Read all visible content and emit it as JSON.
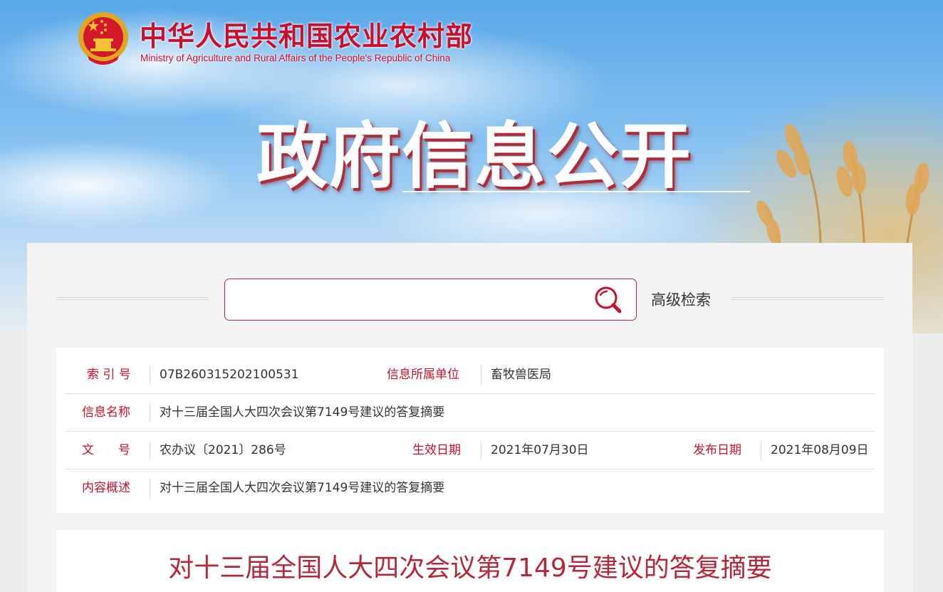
{
  "header": {
    "ministry_cn": "中华人民共和国农业农村部",
    "ministry_en": "Ministry of Agriculture and Rural Affairs of the People's Republic of China",
    "emblem_icon": "national-emblem-icon",
    "title": "政府信息公开"
  },
  "search": {
    "placeholder": "",
    "value": "",
    "button_icon": "search-icon",
    "advanced_label": "高级检索"
  },
  "info": {
    "index_label": "索 引 号",
    "index_value": "07B260315202100531",
    "unit_label": "信息所属单位",
    "unit_value": "畜牧兽医局",
    "name_label": "信息名称",
    "name_value": "对十三届全国人大四次会议第7149号建议的答复摘要",
    "doc_label": "文　　号",
    "doc_value": "农办议〔2021〕286号",
    "effective_label": "生效日期",
    "effective_value": "2021年07月30日",
    "publish_label": "发布日期",
    "publish_value": "2021年08月09日",
    "summary_label": "内容概述",
    "summary_value": "对十三届全国人大四次会议第7149号建议的答复摘要"
  },
  "article": {
    "title": "对十三届全国人大四次会议第7149号建议的答复摘要"
  },
  "colors": {
    "brand_red": "#c8102e",
    "accent_red": "#b5273b",
    "text": "#333333"
  }
}
